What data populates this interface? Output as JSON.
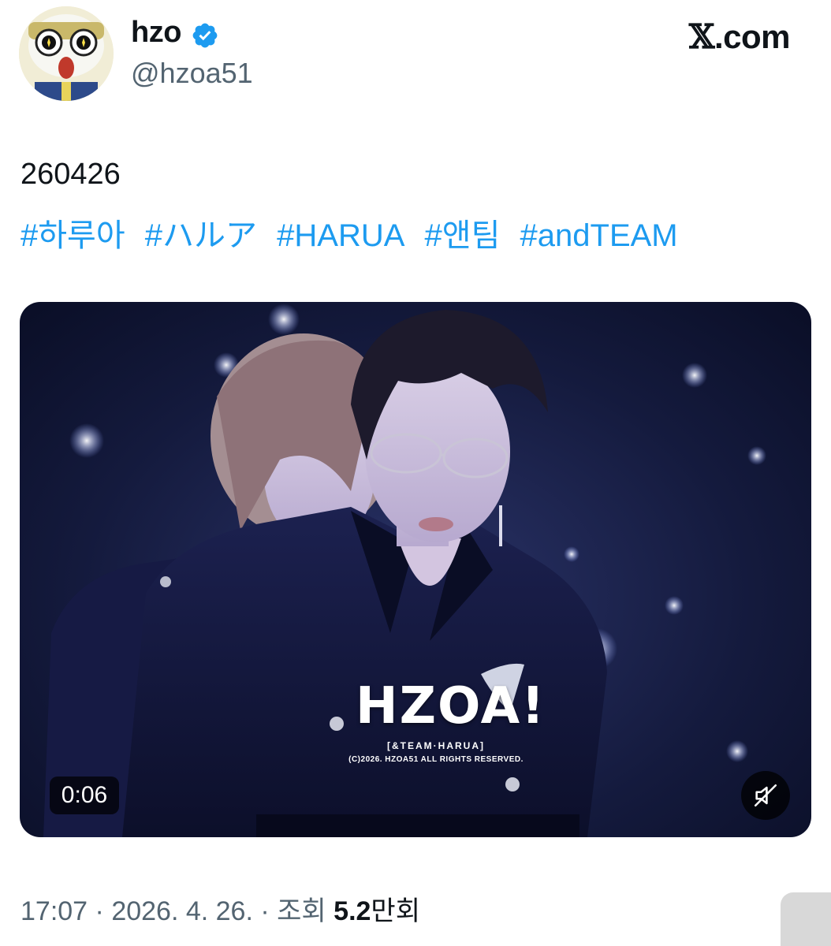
{
  "author": {
    "display_name": "hzo",
    "handle": "@hzoa51",
    "verified": true
  },
  "brand": {
    "x_glyph": "𝕏",
    "domain": ".com"
  },
  "post": {
    "text": "260426",
    "hashtags": [
      "#하루아",
      "#ハルア",
      "#HARUA",
      "#앤팀",
      "#andTEAM"
    ]
  },
  "media": {
    "type": "video",
    "duration": "0:06",
    "muted": true,
    "watermark": {
      "logo": "HZOA!",
      "subtitle": "[&TEAM·HARUA]",
      "copyright": "(C)2026. HZOA51 ALL RIGHTS RESERVED."
    }
  },
  "meta": {
    "time": "17:07",
    "separator": " · ",
    "date": "2026. 4. 26.",
    "views_label": "조회",
    "views_number": "5.2",
    "views_unit": "만회"
  },
  "colors": {
    "link": "#1d9bf0",
    "secondary": "#536471",
    "primary": "#0f1419",
    "verified": "#1d9bf0"
  },
  "icons": {
    "verified": "verified-badge-icon",
    "mute": "speaker-muted-icon"
  }
}
